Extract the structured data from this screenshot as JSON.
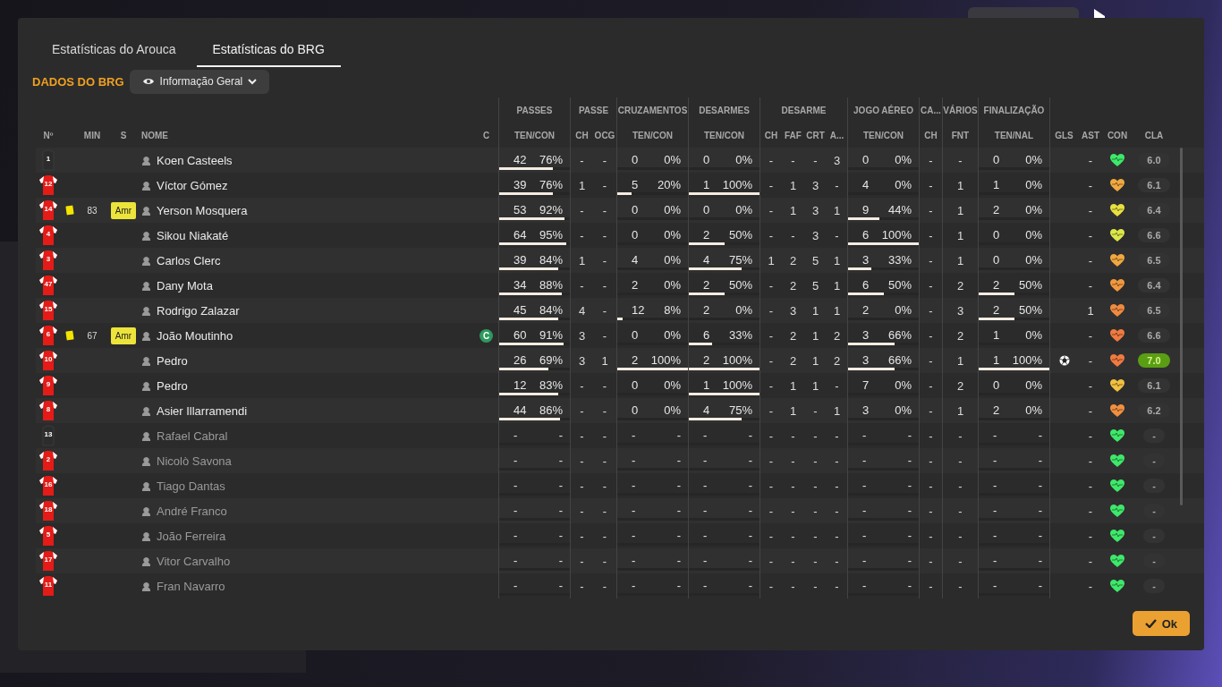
{
  "tabs": [
    {
      "label": "Estatísticas do Arouca",
      "selected": false
    },
    {
      "label": "Estatísticas do BRG",
      "selected": true
    }
  ],
  "section_title": "DADOS DO BRG",
  "view_dropdown": "Informação Geral",
  "table": {
    "left_columns": [
      "Nº",
      "MIN",
      "S",
      "NOME",
      "C"
    ],
    "groups": [
      {
        "label": "PASSES",
        "columns": [
          "TEN/CON"
        ]
      },
      {
        "label": "PASSE",
        "columns": [
          "CH",
          "OCG"
        ]
      },
      {
        "label": "CRUZAMENTOS",
        "columns": [
          "TEN/CON"
        ]
      },
      {
        "label": "DESARMES",
        "columns": [
          "TEN/CON"
        ]
      },
      {
        "label": "DESARME",
        "columns": [
          "CH",
          "FAF",
          "CRT",
          "A..."
        ]
      },
      {
        "label": "JOGO AÉREO",
        "columns": [
          "TEN/CON"
        ]
      },
      {
        "label": "CA...",
        "columns": [
          "CH"
        ]
      },
      {
        "label": "VÁRIOS",
        "columns": [
          "FNT"
        ]
      },
      {
        "label": "FINALIZAÇÃO",
        "columns": [
          "TEN/NAL"
        ]
      }
    ],
    "right_columns": [
      "GLS",
      "AST",
      "CON",
      "CLA"
    ],
    "rows": [
      {
        "number": "1",
        "kind": "keeper",
        "name": "Koen Casteels",
        "dimmed": false,
        "passes": {
          "att": "42",
          "pct": "76%",
          "level": 0.76
        },
        "passe_ch": "-",
        "passe_ocg": "-",
        "crosses": {
          "att": "0",
          "pct": "0%"
        },
        "tackles": {
          "att": "0",
          "pct": "0%"
        },
        "desarme_ch": "-",
        "desarme_faf": "-",
        "desarme_crt": "-",
        "desarme_a": "3",
        "aerial": {
          "att": "0",
          "pct": "0%"
        },
        "ca_ch": "-",
        "fnt": "-",
        "shots": {
          "att": "0",
          "pct": "0%"
        },
        "ast": "-",
        "condition": {
          "color": "#3ee86a"
        },
        "rating": "6.0",
        "best": false
      },
      {
        "number": "12",
        "kind": "outfield",
        "name": "Víctor Gómez",
        "dimmed": false,
        "passes": {
          "att": "39",
          "pct": "76%",
          "level": 0.76
        },
        "passe_ch": "1",
        "passe_ocg": "-",
        "crosses": {
          "att": "5",
          "pct": "20%",
          "level": 0.2
        },
        "tackles": {
          "att": "1",
          "pct": "100%",
          "level": 1
        },
        "desarme_ch": "-",
        "desarme_faf": "1",
        "desarme_crt": "3",
        "desarme_a": "-",
        "aerial": {
          "att": "4",
          "pct": "0%"
        },
        "ca_ch": "-",
        "fnt": "1",
        "shots": {
          "att": "1",
          "pct": "0%"
        },
        "ast": "-",
        "condition": {
          "color": "#f0a840"
        },
        "rating": "6.1",
        "best": false
      },
      {
        "number": "14",
        "kind": "outfield",
        "yellow_card": true,
        "min": "83",
        "sub": "Amr",
        "name": "Yerson Mosquera",
        "dimmed": false,
        "passes": {
          "att": "53",
          "pct": "92%",
          "level": 0.92
        },
        "passe_ch": "-",
        "passe_ocg": "-",
        "crosses": {
          "att": "0",
          "pct": "0%"
        },
        "tackles": {
          "att": "0",
          "pct": "0%"
        },
        "desarme_ch": "-",
        "desarme_faf": "1",
        "desarme_crt": "3",
        "desarme_a": "1",
        "aerial": {
          "att": "9",
          "pct": "44%",
          "level": 0.44
        },
        "ca_ch": "-",
        "fnt": "1",
        "shots": {
          "att": "2",
          "pct": "0%"
        },
        "ast": "-",
        "condition": {
          "color": "#e8e040"
        },
        "rating": "6.4",
        "best": false
      },
      {
        "number": "4",
        "kind": "outfield",
        "name": "Sikou Niakaté",
        "dimmed": false,
        "passes": {
          "att": "64",
          "pct": "95%",
          "level": 0.95
        },
        "passe_ch": "-",
        "passe_ocg": "-",
        "crosses": {
          "att": "0",
          "pct": "0%"
        },
        "tackles": {
          "att": "2",
          "pct": "50%",
          "level": 0.5
        },
        "desarme_ch": "-",
        "desarme_faf": "-",
        "desarme_crt": "3",
        "desarme_a": "-",
        "aerial": {
          "att": "6",
          "pct": "100%",
          "level": 1
        },
        "ca_ch": "-",
        "fnt": "1",
        "shots": {
          "att": "0",
          "pct": "0%"
        },
        "ast": "-",
        "condition": {
          "color": "#dce84a"
        },
        "rating": "6.6",
        "best": false
      },
      {
        "number": "3",
        "kind": "outfield",
        "name": "Carlos Clerc",
        "dimmed": false,
        "passes": {
          "att": "39",
          "pct": "84%",
          "level": 0.84
        },
        "passe_ch": "1",
        "passe_ocg": "-",
        "crosses": {
          "att": "4",
          "pct": "0%"
        },
        "tackles": {
          "att": "4",
          "pct": "75%",
          "level": 0.75
        },
        "desarme_ch": "1",
        "desarme_faf": "2",
        "desarme_crt": "5",
        "desarme_a": "1",
        "aerial": {
          "att": "3",
          "pct": "33%",
          "level": 0.33
        },
        "ca_ch": "-",
        "fnt": "1",
        "shots": {
          "att": "0",
          "pct": "0%"
        },
        "ast": "-",
        "condition": {
          "color": "#f0a840"
        },
        "rating": "6.5",
        "best": false
      },
      {
        "number": "47",
        "kind": "outfield",
        "name": "Dany Mota",
        "dimmed": false,
        "passes": {
          "att": "34",
          "pct": "88%",
          "level": 0.88
        },
        "passe_ch": "-",
        "passe_ocg": "-",
        "crosses": {
          "att": "2",
          "pct": "0%"
        },
        "tackles": {
          "att": "2",
          "pct": "50%",
          "level": 0.5
        },
        "desarme_ch": "-",
        "desarme_faf": "2",
        "desarme_crt": "5",
        "desarme_a": "1",
        "aerial": {
          "att": "6",
          "pct": "50%",
          "level": 0.5
        },
        "ca_ch": "-",
        "fnt": "2",
        "shots": {
          "att": "2",
          "pct": "50%",
          "level": 0.5
        },
        "ast": "-",
        "condition": {
          "color": "#f09840"
        },
        "rating": "6.4",
        "best": false
      },
      {
        "number": "15",
        "kind": "outfield",
        "name": "Rodrigo Zalazar",
        "dimmed": false,
        "passes": {
          "att": "45",
          "pct": "84%",
          "level": 0.84
        },
        "passe_ch": "4",
        "passe_ocg": "-",
        "crosses": {
          "att": "12",
          "pct": "8%",
          "level": 0.08
        },
        "tackles": {
          "att": "2",
          "pct": "0%"
        },
        "desarme_ch": "-",
        "desarme_faf": "3",
        "desarme_crt": "1",
        "desarme_a": "1",
        "aerial": {
          "att": "2",
          "pct": "0%"
        },
        "ca_ch": "-",
        "fnt": "3",
        "shots": {
          "att": "2",
          "pct": "50%",
          "level": 0.5
        },
        "ast": "1",
        "condition": {
          "color": "#f08a40"
        },
        "rating": "6.5",
        "best": false
      },
      {
        "number": "6",
        "kind": "outfield",
        "yellow_card": true,
        "min": "67",
        "sub": "Amr",
        "name": "João Moutinho",
        "captain": "C",
        "dimmed": false,
        "passes": {
          "att": "60",
          "pct": "91%",
          "level": 0.91
        },
        "passe_ch": "3",
        "passe_ocg": "-",
        "crosses": {
          "att": "0",
          "pct": "0%"
        },
        "tackles": {
          "att": "6",
          "pct": "33%",
          "level": 0.33
        },
        "desarme_ch": "-",
        "desarme_faf": "2",
        "desarme_crt": "1",
        "desarme_a": "2",
        "aerial": {
          "att": "3",
          "pct": "66%",
          "level": 0.66
        },
        "ca_ch": "-",
        "fnt": "2",
        "shots": {
          "att": "1",
          "pct": "0%"
        },
        "ast": "-",
        "condition": {
          "color": "#f07a40"
        },
        "rating": "6.6",
        "best": false
      },
      {
        "number": "10",
        "kind": "outfield",
        "name": "Pedro",
        "dimmed": false,
        "passes": {
          "att": "26",
          "pct": "69%",
          "level": 0.69
        },
        "passe_ch": "3",
        "passe_ocg": "1",
        "crosses": {
          "att": "2",
          "pct": "100%",
          "level": 1
        },
        "tackles": {
          "att": "2",
          "pct": "100%",
          "level": 1
        },
        "desarme_ch": "-",
        "desarme_faf": "2",
        "desarme_crt": "1",
        "desarme_a": "2",
        "aerial": {
          "att": "3",
          "pct": "66%",
          "level": 0.66
        },
        "ca_ch": "-",
        "fnt": "1",
        "shots": {
          "att": "1",
          "pct": "100%",
          "level": 1
        },
        "goal": true,
        "ast": "-",
        "condition": {
          "color": "#f07a40"
        },
        "rating": "7.0",
        "best": true
      },
      {
        "number": "9",
        "kind": "outfield",
        "name": "Pedro",
        "dimmed": false,
        "passes": {
          "att": "12",
          "pct": "83%",
          "level": 0.83
        },
        "passe_ch": "-",
        "passe_ocg": "-",
        "crosses": {
          "att": "0",
          "pct": "0%"
        },
        "tackles": {
          "att": "1",
          "pct": "100%",
          "level": 1
        },
        "desarme_ch": "-",
        "desarme_faf": "1",
        "desarme_crt": "1",
        "desarme_a": "-",
        "aerial": {
          "att": "7",
          "pct": "0%"
        },
        "ca_ch": "-",
        "fnt": "2",
        "shots": {
          "att": "0",
          "pct": "0%"
        },
        "ast": "-",
        "condition": {
          "color": "#f0c040"
        },
        "rating": "6.1",
        "best": false
      },
      {
        "number": "8",
        "kind": "outfield",
        "name": "Asier Illarramendi",
        "dimmed": false,
        "passes": {
          "att": "44",
          "pct": "86%",
          "level": 0.86
        },
        "passe_ch": "-",
        "passe_ocg": "-",
        "crosses": {
          "att": "0",
          "pct": "0%"
        },
        "tackles": {
          "att": "4",
          "pct": "75%",
          "level": 0.75
        },
        "desarme_ch": "-",
        "desarme_faf": "1",
        "desarme_crt": "-",
        "desarme_a": "1",
        "aerial": {
          "att": "3",
          "pct": "0%"
        },
        "ca_ch": "-",
        "fnt": "1",
        "shots": {
          "att": "2",
          "pct": "0%"
        },
        "ast": "-",
        "condition": {
          "color": "#f09040"
        },
        "rating": "6.2",
        "best": false
      },
      {
        "number": "13",
        "kind": "keeper",
        "name": "Rafael Cabral",
        "dimmed": true,
        "passes": {
          "att": "-",
          "pct": "-"
        },
        "passe_ch": "-",
        "passe_ocg": "-",
        "crosses": {
          "att": "-",
          "pct": "-"
        },
        "tackles": {
          "att": "-",
          "pct": "-"
        },
        "desarme_ch": "-",
        "desarme_faf": "-",
        "desarme_crt": "-",
        "desarme_a": "-",
        "aerial": {
          "att": "-",
          "pct": "-"
        },
        "ca_ch": "-",
        "fnt": "-",
        "shots": {
          "att": "-",
          "pct": "-"
        },
        "ast": "-",
        "condition": {
          "color": "#3ee86a"
        },
        "rating": "-",
        "best": false
      },
      {
        "number": "2",
        "kind": "outfield",
        "name": "Nicolò Savona",
        "dimmed": true,
        "passes": {
          "att": "-",
          "pct": "-"
        },
        "passe_ch": "-",
        "passe_ocg": "-",
        "crosses": {
          "att": "-",
          "pct": "-"
        },
        "tackles": {
          "att": "-",
          "pct": "-"
        },
        "desarme_ch": "-",
        "desarme_faf": "-",
        "desarme_crt": "-",
        "desarme_a": "-",
        "aerial": {
          "att": "-",
          "pct": "-"
        },
        "ca_ch": "-",
        "fnt": "-",
        "shots": {
          "att": "-",
          "pct": "-"
        },
        "ast": "-",
        "condition": {
          "color": "#3ee86a"
        },
        "rating": "-",
        "best": false
      },
      {
        "number": "16",
        "kind": "outfield",
        "name": "Tiago Dantas",
        "dimmed": true,
        "passes": {
          "att": "-",
          "pct": "-"
        },
        "passe_ch": "-",
        "passe_ocg": "-",
        "crosses": {
          "att": "-",
          "pct": "-"
        },
        "tackles": {
          "att": "-",
          "pct": "-"
        },
        "desarme_ch": "-",
        "desarme_faf": "-",
        "desarme_crt": "-",
        "desarme_a": "-",
        "aerial": {
          "att": "-",
          "pct": "-"
        },
        "ca_ch": "-",
        "fnt": "-",
        "shots": {
          "att": "-",
          "pct": "-"
        },
        "ast": "-",
        "condition": {
          "color": "#3ee86a"
        },
        "rating": "-",
        "best": false
      },
      {
        "number": "18",
        "kind": "outfield",
        "name": "André Franco",
        "dimmed": true,
        "passes": {
          "att": "-",
          "pct": "-"
        },
        "passe_ch": "-",
        "passe_ocg": "-",
        "crosses": {
          "att": "-",
          "pct": "-"
        },
        "tackles": {
          "att": "-",
          "pct": "-"
        },
        "desarme_ch": "-",
        "desarme_faf": "-",
        "desarme_crt": "-",
        "desarme_a": "-",
        "aerial": {
          "att": "-",
          "pct": "-"
        },
        "ca_ch": "-",
        "fnt": "-",
        "shots": {
          "att": "-",
          "pct": "-"
        },
        "ast": "-",
        "condition": {
          "color": "#3ee86a"
        },
        "rating": "-",
        "best": false
      },
      {
        "number": "5",
        "kind": "outfield",
        "name": "João Ferreira",
        "dimmed": true,
        "passes": {
          "att": "-",
          "pct": "-"
        },
        "passe_ch": "-",
        "passe_ocg": "-",
        "crosses": {
          "att": "-",
          "pct": "-"
        },
        "tackles": {
          "att": "-",
          "pct": "-"
        },
        "desarme_ch": "-",
        "desarme_faf": "-",
        "desarme_crt": "-",
        "desarme_a": "-",
        "aerial": {
          "att": "-",
          "pct": "-"
        },
        "ca_ch": "-",
        "fnt": "-",
        "shots": {
          "att": "-",
          "pct": "-"
        },
        "ast": "-",
        "condition": {
          "color": "#3ee86a"
        },
        "rating": "-",
        "best": false
      },
      {
        "number": "17",
        "kind": "outfield",
        "name": "Vitor Carvalho",
        "dimmed": true,
        "passes": {
          "att": "-",
          "pct": "-"
        },
        "passe_ch": "-",
        "passe_ocg": "-",
        "crosses": {
          "att": "-",
          "pct": "-"
        },
        "tackles": {
          "att": "-",
          "pct": "-"
        },
        "desarme_ch": "-",
        "desarme_faf": "-",
        "desarme_crt": "-",
        "desarme_a": "-",
        "aerial": {
          "att": "-",
          "pct": "-"
        },
        "ca_ch": "-",
        "fnt": "-",
        "shots": {
          "att": "-",
          "pct": "-"
        },
        "ast": "-",
        "condition": {
          "color": "#3ee86a"
        },
        "rating": "-",
        "best": false
      },
      {
        "number": "11",
        "kind": "outfield",
        "name": "Fran Navarro",
        "dimmed": true,
        "passes": {
          "att": "-",
          "pct": "-"
        },
        "passe_ch": "-",
        "passe_ocg": "-",
        "crosses": {
          "att": "-",
          "pct": "-"
        },
        "tackles": {
          "att": "-",
          "pct": "-"
        },
        "desarme_ch": "-",
        "desarme_faf": "-",
        "desarme_crt": "-",
        "desarme_a": "-",
        "aerial": {
          "att": "-",
          "pct": "-"
        },
        "ca_ch": "-",
        "fnt": "-",
        "shots": {
          "att": "-",
          "pct": "-"
        },
        "ast": "-",
        "condition": {
          "color": "#3ee86a"
        },
        "rating": "-",
        "best": false
      }
    ]
  },
  "ok_button": "Ok"
}
